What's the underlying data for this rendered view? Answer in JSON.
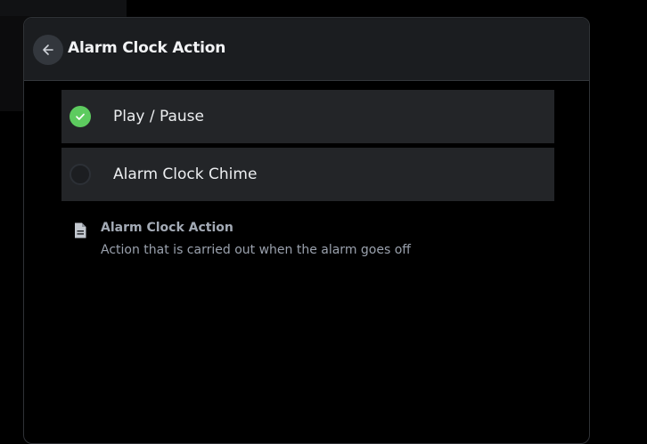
{
  "header": {
    "title": "Alarm Clock Action",
    "back_icon": "arrow-left-icon"
  },
  "options": [
    {
      "label": "Play / Pause",
      "selected": true,
      "icon": "check-circle-icon"
    },
    {
      "label": "Alarm Clock Chime",
      "selected": false,
      "icon": "empty-radio-icon"
    }
  ],
  "info": {
    "icon": "document-icon",
    "title": "Alarm Clock Action",
    "description": "Action that is carried out when the alarm goes off"
  },
  "colors": {
    "accent": "#5dcb5f",
    "header_bg": "#1b1d20",
    "option_bg": "#232528",
    "page_bg": "#000000"
  }
}
